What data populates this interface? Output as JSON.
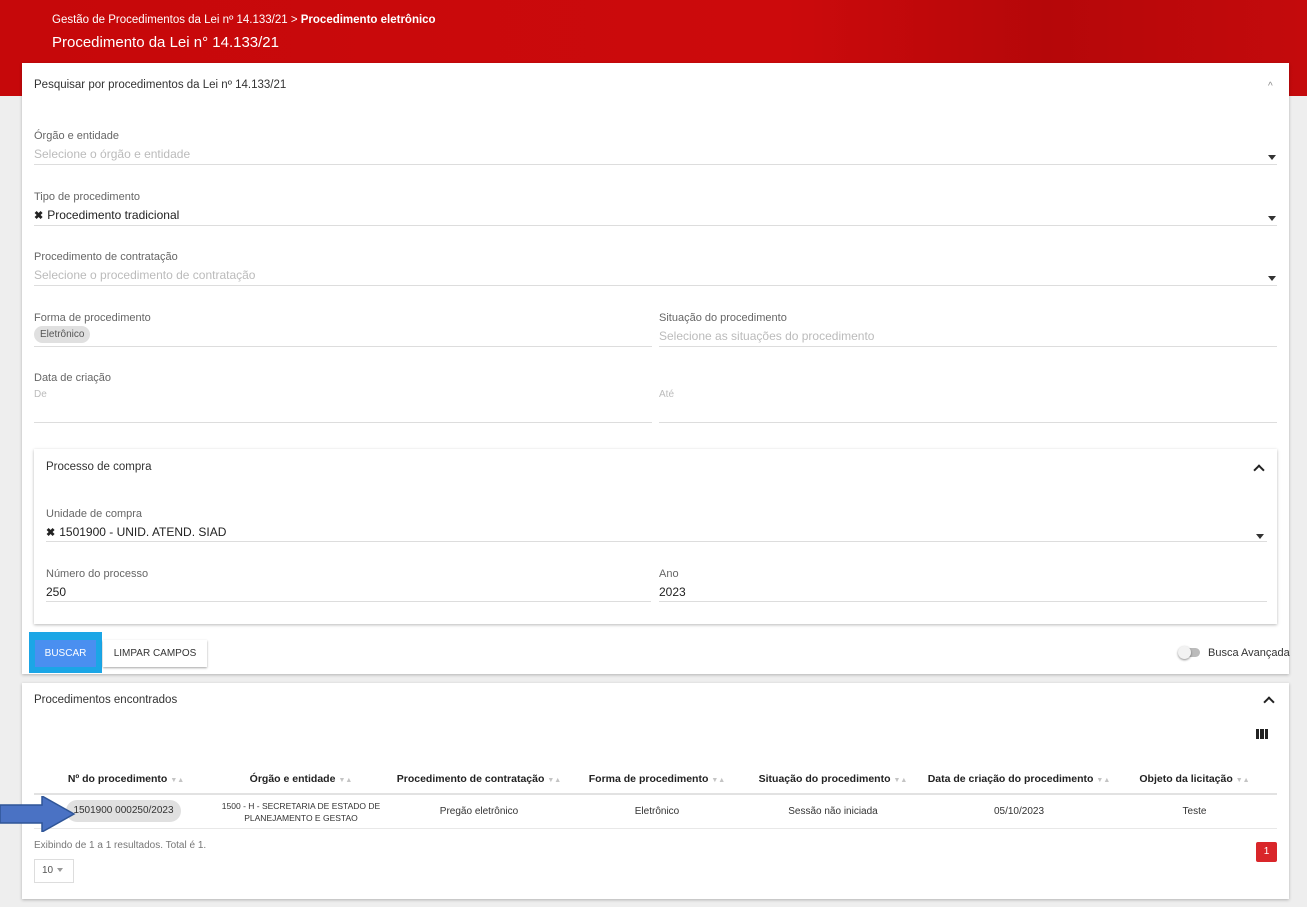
{
  "header": {
    "breadcrumb_prefix": "Gestão de Procedimentos da Lei nº 14.133/21",
    "breadcrumb_sep": " > ",
    "breadcrumb_current": "Procedimento eletrônico",
    "title": "Procedimento da Lei n° 14.133/21"
  },
  "search": {
    "title": "Pesquisar por procedimentos da Lei nº 14.133/21",
    "orgao": {
      "label": "Órgão e entidade",
      "placeholder": "Selecione o órgão e entidade"
    },
    "tipo": {
      "label": "Tipo de procedimento",
      "value": "Procedimento tradicional"
    },
    "contratacao": {
      "label": "Procedimento de contratação",
      "placeholder": "Selecione o procedimento de contratação"
    },
    "forma": {
      "label": "Forma de procedimento",
      "chip": "Eletrônico"
    },
    "situacao": {
      "label": "Situação do procedimento",
      "placeholder": "Selecione as situações do procedimento"
    },
    "data": {
      "label": "Data de criação",
      "from_placeholder": "De",
      "to_placeholder": "Até"
    },
    "processo": {
      "title": "Processo de compra",
      "unidade": {
        "label": "Unidade de compra",
        "value": "1501900 - UNID. ATEND. SIAD"
      },
      "numero": {
        "label": "Número do processo",
        "value": "250"
      },
      "ano": {
        "label": "Ano",
        "value": "2023"
      }
    },
    "buttons": {
      "search": "BUSCAR",
      "clear": "LIMPAR CAMPOS"
    },
    "advanced": {
      "label": "Busca Avançada",
      "enabled": false
    }
  },
  "results": {
    "title": "Procedimentos encontrados",
    "columns": [
      "Nº do procedimento",
      "Órgão e entidade",
      "Procedimento de contratação",
      "Forma de procedimento",
      "Situação do procedimento",
      "Data de criação do procedimento",
      "Objeto da licitação"
    ],
    "rows": [
      {
        "numero": "1501900 000250/2023",
        "orgao_1": "1500 - H - SECRETARIA DE ESTADO DE",
        "orgao_2": "PLANEJAMENTO E GESTAO",
        "contratacao": "Pregão eletrônico",
        "forma": "Eletrônico",
        "situacao": "Sessão não iniciada",
        "data": "05/10/2023",
        "objeto": "Teste"
      }
    ],
    "summary": "Exibindo de 1 a 1 resultados. Total é 1.",
    "page_size": "10",
    "current_page": "1"
  },
  "colors": {
    "header_red": "#c8090b",
    "primary_blue": "#4a8ff0",
    "highlight": "#1ba6e6",
    "pagination_red": "#d9262a",
    "arrow_blue": "#4a72c4"
  }
}
